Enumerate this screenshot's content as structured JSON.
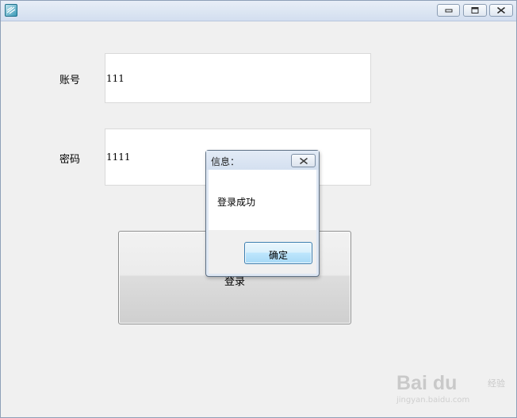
{
  "window": {
    "title": "",
    "icons": {
      "app": "app-icon",
      "minimize": "minimize-icon",
      "maximize": "maximize-icon",
      "close": "close-icon"
    }
  },
  "form": {
    "account_label": "账号",
    "account_value": "111",
    "password_label": "密码",
    "password_value": "1111",
    "login_button_label": "登录"
  },
  "dialog": {
    "title": "信息：",
    "message": "登录成功",
    "ok_label": "确定"
  },
  "watermark": {
    "brand": "Bai du",
    "sub": "经验",
    "url": "jingyan.baidu.com"
  },
  "colors": {
    "window_bg": "#f0f0f0",
    "titlebar": "#dbe5f2",
    "dialog_accent": "#3c7fb1"
  }
}
